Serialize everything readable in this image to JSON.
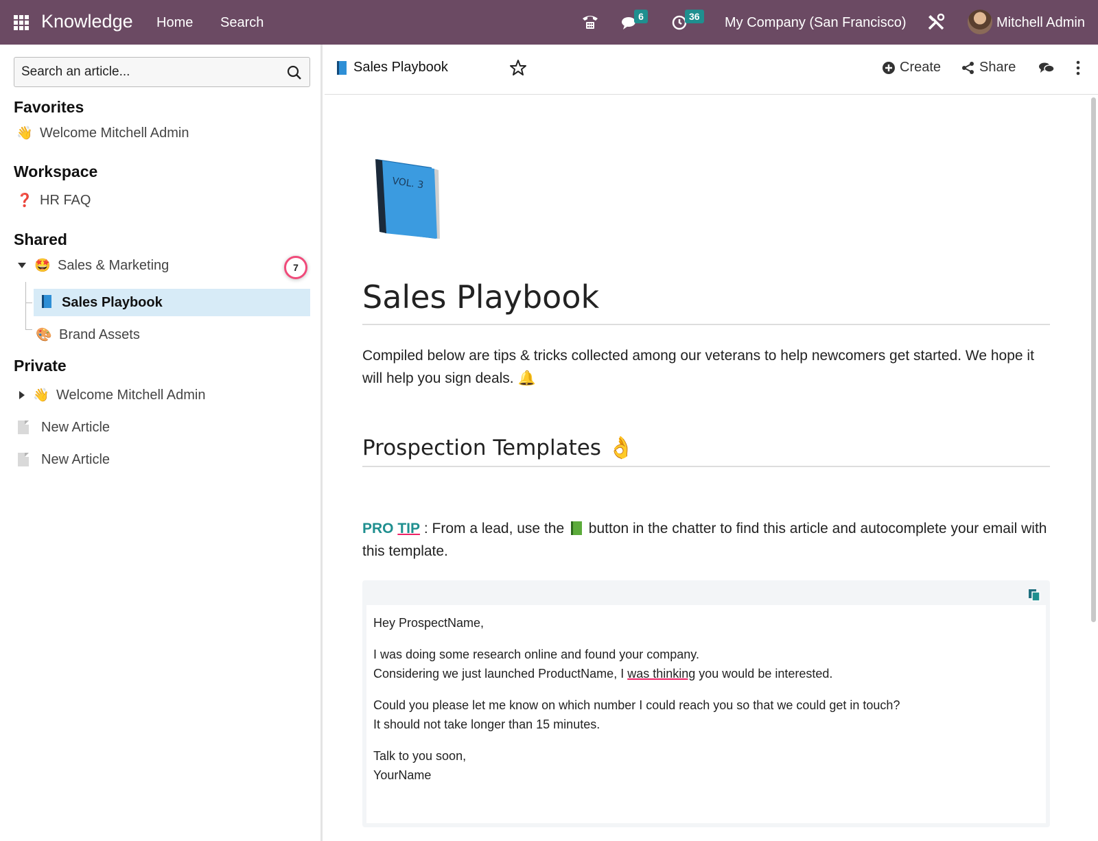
{
  "topbar": {
    "app_name": "Knowledge",
    "nav_home": "Home",
    "nav_search": "Search",
    "messages_count": "6",
    "activities_count": "36",
    "company": "My Company (San Francisco)",
    "user_name": "Mitchell Admin"
  },
  "sidebar": {
    "search_placeholder": "Search an article...",
    "favorites_title": "Favorites",
    "favorites": [
      {
        "emoji": "👋",
        "label": "Welcome Mitchell Admin"
      }
    ],
    "workspace_title": "Workspace",
    "workspace": [
      {
        "emoji": "❓",
        "label": "HR FAQ"
      }
    ],
    "shared_title": "Shared",
    "shared": {
      "parent": {
        "emoji": "🤩",
        "label": "Sales & Marketing"
      },
      "parent_count": "7",
      "children": [
        {
          "label": "Sales Playbook"
        },
        {
          "emoji": "🎨",
          "label": "Brand Assets"
        }
      ]
    },
    "private_title": "Private",
    "private": [
      {
        "emoji": "👋",
        "label": "Welcome Mitchell Admin"
      },
      {
        "label": "New Article"
      },
      {
        "label": "New Article"
      }
    ]
  },
  "header": {
    "breadcrumb": "Sales Playbook",
    "create_label": "Create",
    "share_label": "Share"
  },
  "article": {
    "title": "Sales Playbook",
    "intro": "Compiled below are tips & tricks collected among our veterans to help newcomers get started. We hope it will help you sign deals. 🔔",
    "section_title": "Prospection Templates 👌",
    "protip_label_1": "PRO ",
    "protip_label_2": "TIP",
    "protip_text_1": " : From a lead, use the ",
    "protip_text_2": " button in the chatter to find this article and autocomplete your email with this template.",
    "template": {
      "greeting": "Hey ProspectName,",
      "line1": "I was doing some research online and found your company.",
      "line2_a": "Considering we just launched ProductName, I ",
      "line2_b": "was thinking",
      "line2_c": " you would be interested.",
      "line3": "Could you please let me know on which number I could reach you so that we could get in touch?",
      "line4": "It should not take longer than 15 minutes.",
      "closing": "Talk to you soon,",
      "signature": "YourName"
    }
  },
  "colors": {
    "navbar": "#6b4a63",
    "accent_teal": "#1f8f8f",
    "selected_row": "#d7ebf7"
  },
  "icons": [
    "apps-icon",
    "phone-icon",
    "chat-icon",
    "clock-icon",
    "tools-icon",
    "search-icon",
    "star-icon",
    "plus-circle-icon",
    "share-icon",
    "comments-icon",
    "kebab-icon",
    "copy-icon"
  ]
}
